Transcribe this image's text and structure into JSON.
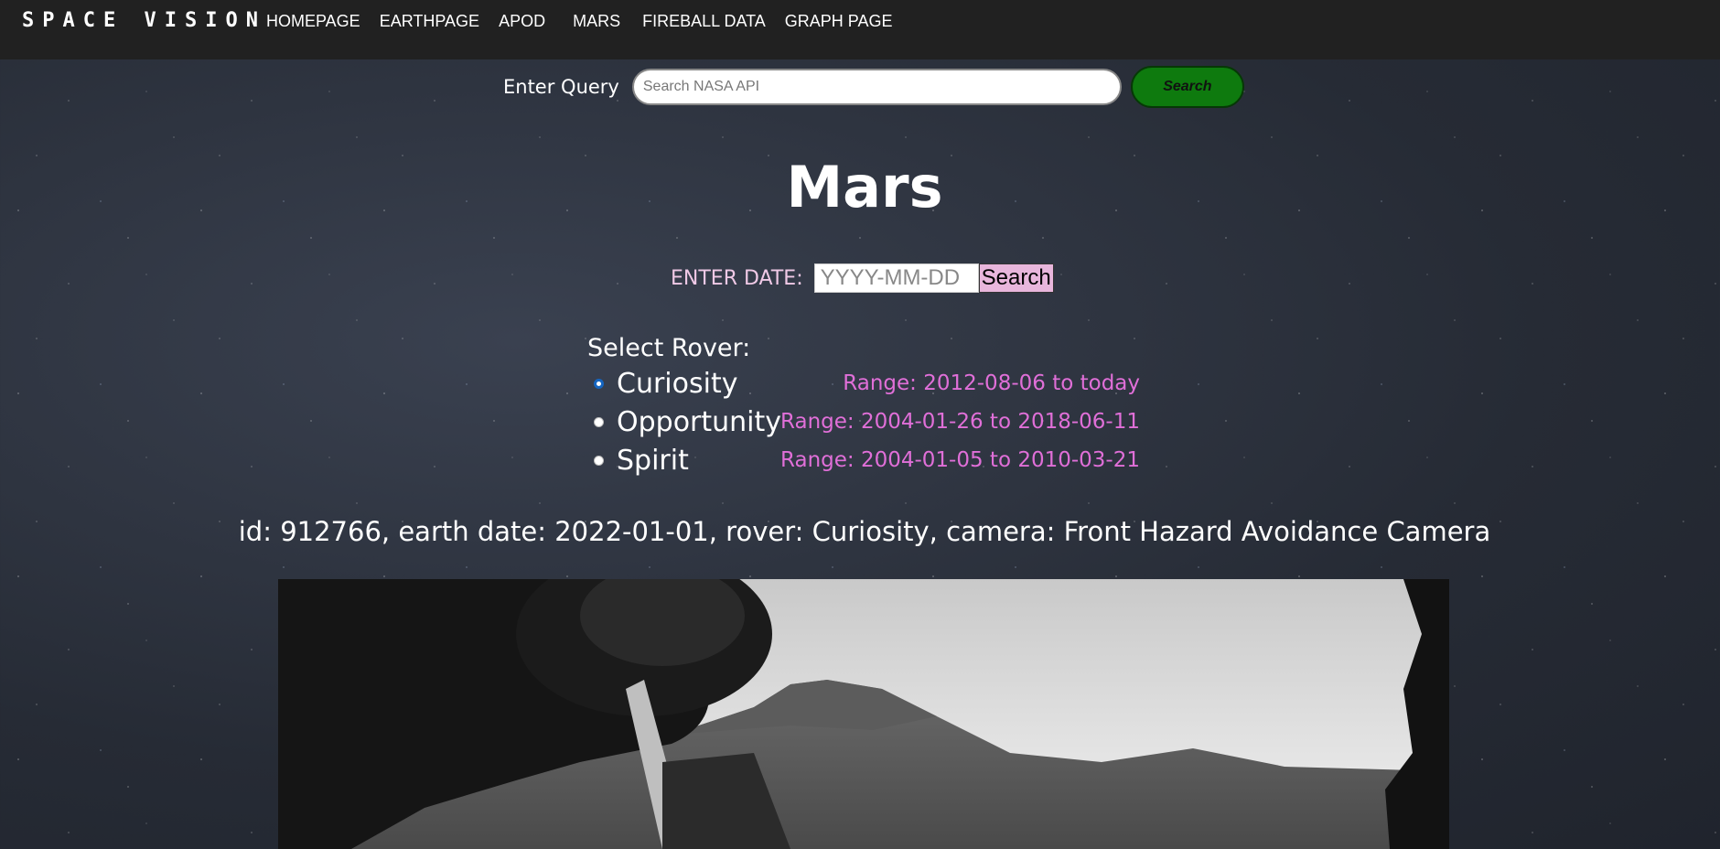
{
  "navbar": {
    "brand": "SPACE VISION",
    "links": [
      "HOMEPAGE",
      "EARTHPAGE",
      "APOD",
      "MARS",
      "FIREBALL DATA",
      "GRAPH PAGE"
    ]
  },
  "query": {
    "label": "Enter Query",
    "placeholder": "Search NASA API",
    "button_label": "Search"
  },
  "page_title": "Mars",
  "date_search": {
    "label": "ENTER DATE:",
    "placeholder": "YYYY-MM-DD",
    "button_label": "Search"
  },
  "rover_select": {
    "title": "Select Rover:",
    "options": [
      {
        "name": "Curiosity",
        "range": "Range: 2012-08-06 to today",
        "checked": true
      },
      {
        "name": "Opportunity",
        "range": "Range: 2004-01-26 to 2018-06-11",
        "checked": false
      },
      {
        "name": "Spirit",
        "range": "Range: 2004-01-05 to 2010-03-21",
        "checked": false
      }
    ]
  },
  "photo": {
    "caption": "id: 912766, earth date: 2022-01-01, rover: Curiosity, camera: Front Hazard Avoidance Camera"
  },
  "colors": {
    "navbar_bg": "#212121",
    "search_button": "#0e7a0e",
    "range_text": "#e06fd8",
    "date_label": "#f0c9e6",
    "date_button": "#e8b6dc"
  }
}
